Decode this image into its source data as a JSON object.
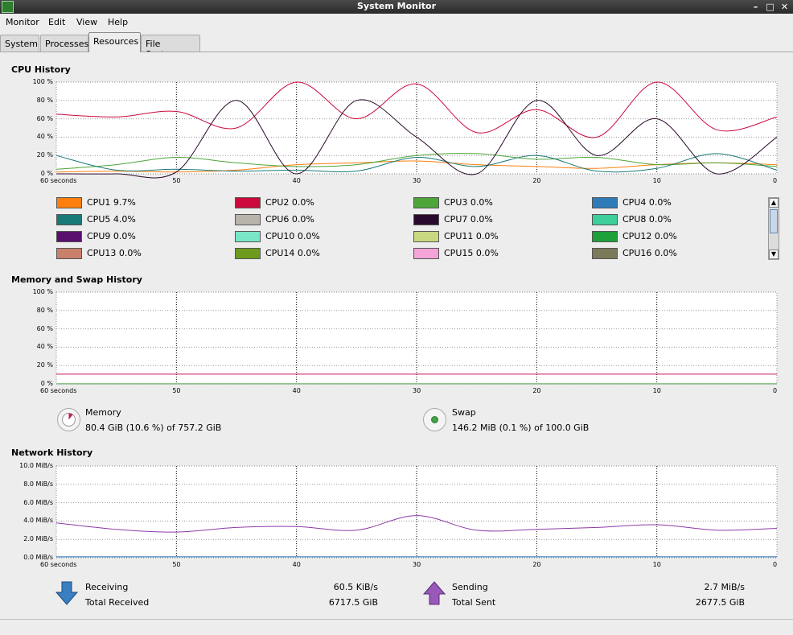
{
  "window": {
    "title": "System Monitor",
    "minimize": "–",
    "maximize": "□",
    "close": "✕"
  },
  "menu": [
    "Monitor",
    "Edit",
    "View",
    "Help"
  ],
  "tabs": [
    {
      "label": "System",
      "active": false
    },
    {
      "label": "Processes",
      "active": false
    },
    {
      "label": "Resources",
      "active": true
    },
    {
      "label": "File Systems",
      "active": false
    }
  ],
  "icons": {
    "app": "system-monitor-icon",
    "scroll_up": "▲",
    "scroll_down": "▼"
  },
  "cpu": {
    "title": "CPU History",
    "yticks": [
      "100 %",
      "80 %",
      "60 %",
      "40 %",
      "20 %",
      "0 %"
    ],
    "xticks": [
      "60 seconds",
      "50",
      "40",
      "30",
      "20",
      "10",
      "0"
    ],
    "legend": [
      {
        "name": "CPU1",
        "value": "9.7%",
        "color": "#ff7f0e"
      },
      {
        "name": "CPU2",
        "value": "0.0%",
        "color": "#cc0a3c"
      },
      {
        "name": "CPU3",
        "value": "0.0%",
        "color": "#4ea53a"
      },
      {
        "name": "CPU4",
        "value": "0.0%",
        "color": "#2f7ab9"
      },
      {
        "name": "CPU5",
        "value": "4.0%",
        "color": "#1a7a78"
      },
      {
        "name": "CPU6",
        "value": "0.0%",
        "color": "#b8b4ac"
      },
      {
        "name": "CPU7",
        "value": "0.0%",
        "color": "#2a0a2c"
      },
      {
        "name": "CPU8",
        "value": "0.0%",
        "color": "#3ecf9a"
      },
      {
        "name": "CPU9",
        "value": "0.0%",
        "color": "#5a0f6e"
      },
      {
        "name": "CPU10",
        "value": "0.0%",
        "color": "#7ae6c8"
      },
      {
        "name": "CPU11",
        "value": "0.0%",
        "color": "#c8d880"
      },
      {
        "name": "CPU12",
        "value": "0.0%",
        "color": "#1ea03a"
      },
      {
        "name": "CPU13",
        "value": "0.0%",
        "color": "#c8806a"
      },
      {
        "name": "CPU14",
        "value": "0.0%",
        "color": "#6e9a1e"
      },
      {
        "name": "CPU15",
        "value": "0.0%",
        "color": "#f4a4d8"
      },
      {
        "name": "CPU16",
        "value": "0.0%",
        "color": "#7a7a5a"
      }
    ]
  },
  "memory": {
    "title": "Memory and Swap History",
    "yticks": [
      "100 %",
      "80 %",
      "60 %",
      "40 %",
      "20 %",
      "0 %"
    ],
    "xticks": [
      "60 seconds",
      "50",
      "40",
      "30",
      "20",
      "10",
      "0"
    ],
    "memory_label": "Memory",
    "memory_value": "80.4 GiB (10.6 %) of 757.2 GiB",
    "memory_percent": 10.6,
    "memory_color": "#c2185b",
    "swap_label": "Swap",
    "swap_value": "146.2 MiB (0.1 %) of 100.0 GiB",
    "swap_percent": 0.1,
    "swap_color": "#43a047"
  },
  "network": {
    "title": "Network History",
    "yticks": [
      "10.0 MiB/s",
      "8.0 MiB/s",
      "6.0 MiB/s",
      "4.0 MiB/s",
      "2.0 MiB/s",
      "0.0 MiB/s"
    ],
    "xticks": [
      "60 seconds",
      "50",
      "40",
      "30",
      "20",
      "10",
      "0"
    ],
    "receiving_label": "Receiving",
    "receiving_value": "60.5 KiB/s",
    "total_received_label": "Total Received",
    "total_received_value": "6717.5 GiB",
    "sending_label": "Sending",
    "sending_value": "2.7 MiB/s",
    "total_sent_label": "Total Sent",
    "total_sent_value": "2677.5 GiB",
    "receiving_color": "#1e6ab0",
    "sending_color": "#8e3aa8"
  },
  "chart_data": [
    {
      "type": "line",
      "title": "CPU History",
      "x": [
        60,
        55,
        50,
        45,
        40,
        35,
        30,
        25,
        20,
        15,
        10,
        5,
        0
      ],
      "ylim": [
        0,
        100
      ],
      "xlim": [
        60,
        0
      ],
      "series": [
        {
          "name": "CPU1",
          "values": [
            2,
            3,
            2,
            4,
            10,
            12,
            14,
            10,
            8,
            6,
            10,
            12,
            10
          ]
        },
        {
          "name": "CPU2",
          "values": [
            65,
            62,
            68,
            50,
            100,
            60,
            98,
            45,
            70,
            40,
            100,
            48,
            62
          ]
        },
        {
          "name": "CPU3",
          "values": [
            5,
            10,
            18,
            12,
            8,
            10,
            20,
            22,
            16,
            18,
            10,
            12,
            8
          ]
        },
        {
          "name": "CPU5",
          "values": [
            20,
            4,
            5,
            3,
            4,
            3,
            18,
            8,
            20,
            3,
            6,
            22,
            4
          ]
        },
        {
          "name": "CPU7",
          "values": [
            0,
            0,
            2,
            80,
            0,
            80,
            40,
            0,
            80,
            20,
            60,
            0,
            40
          ]
        }
      ]
    },
    {
      "type": "line",
      "title": "Memory and Swap History",
      "x": [
        60,
        0
      ],
      "ylim": [
        0,
        100
      ],
      "xlim": [
        60,
        0
      ],
      "series": [
        {
          "name": "Memory",
          "values": [
            10.6,
            10.6
          ]
        },
        {
          "name": "Swap",
          "values": [
            0.1,
            0.1
          ]
        }
      ]
    },
    {
      "type": "line",
      "title": "Network History",
      "x": [
        60,
        55,
        50,
        45,
        40,
        35,
        30,
        25,
        20,
        15,
        10,
        5,
        0
      ],
      "ylim": [
        0,
        10
      ],
      "xlim": [
        60,
        0
      ],
      "series": [
        {
          "name": "Receiving",
          "values": [
            0.1,
            0.1,
            0.1,
            0.1,
            0.1,
            0.1,
            0.1,
            0.1,
            0.1,
            0.1,
            0.1,
            0.1,
            0.1
          ]
        },
        {
          "name": "Sending",
          "values": [
            3.8,
            3.1,
            2.8,
            3.3,
            3.4,
            3.0,
            4.6,
            3.0,
            3.1,
            3.3,
            3.6,
            3.0,
            3.2
          ]
        }
      ]
    }
  ]
}
